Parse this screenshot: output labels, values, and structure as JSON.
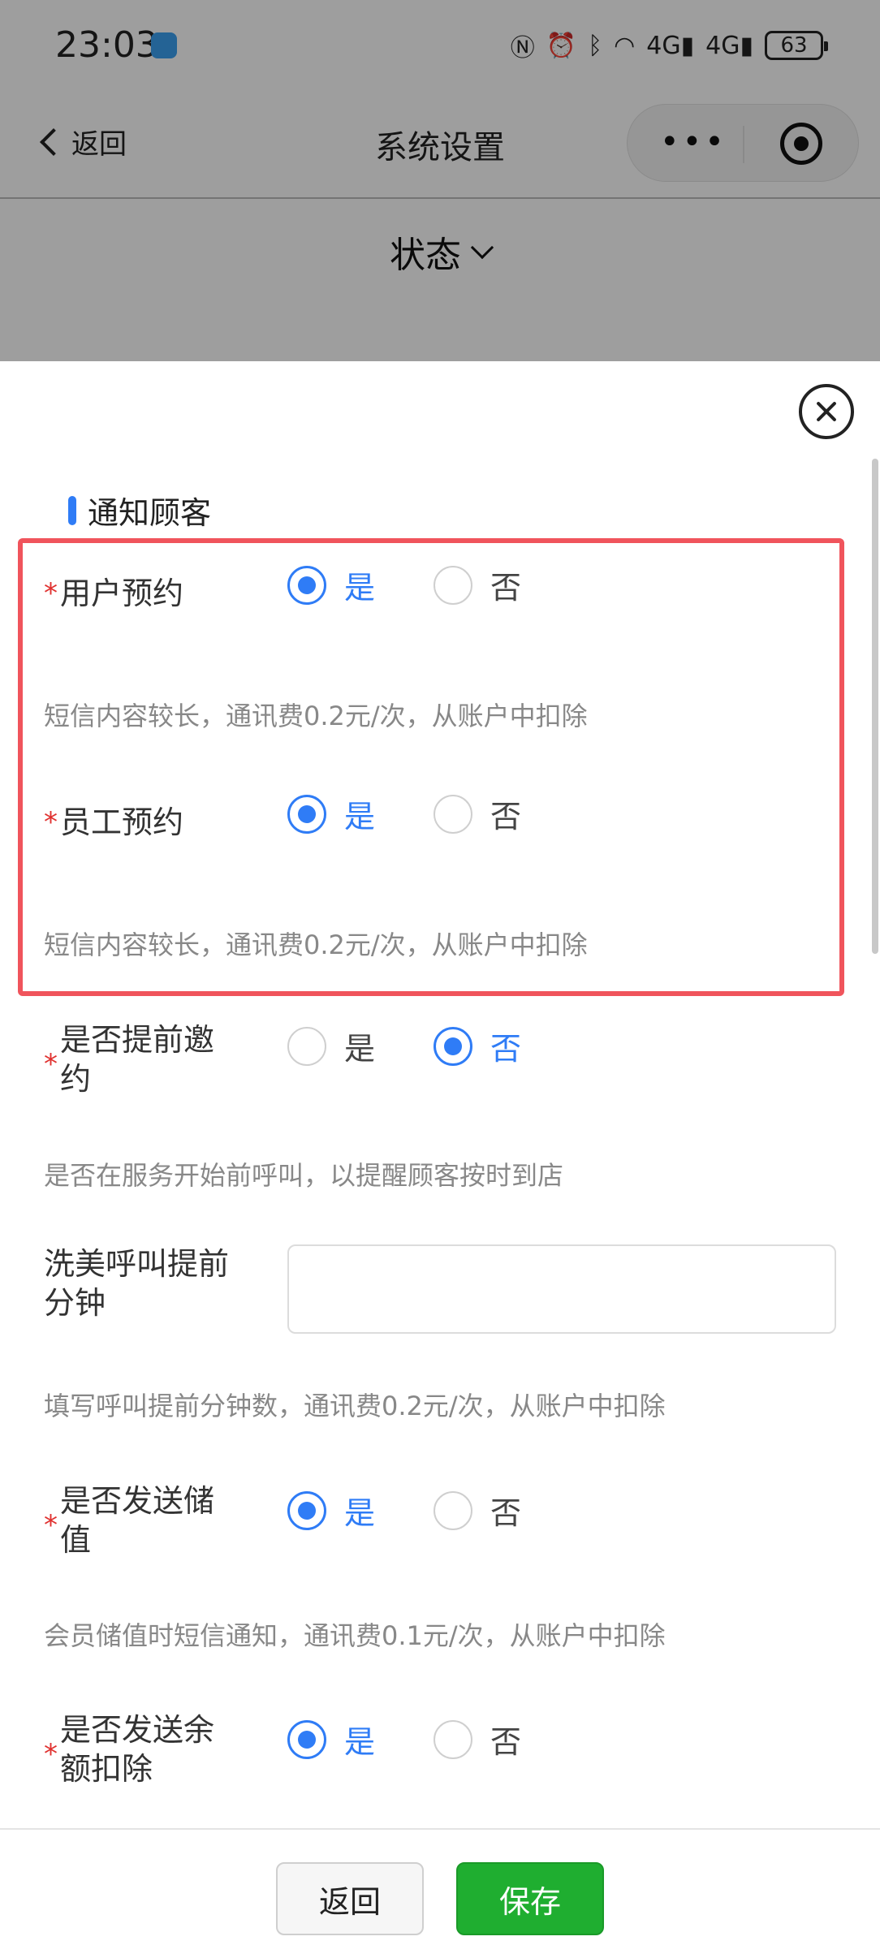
{
  "status_bar": {
    "time": "23:03",
    "icons": [
      "nfc-icon",
      "alarm-icon",
      "bluetooth-icon",
      "wifi-icon",
      "4g-signal-icon",
      "4g-signal-icon"
    ],
    "net1": "4G",
    "net2": "4G",
    "battery": "63"
  },
  "nav": {
    "back_label": "返回",
    "title": "系统设置"
  },
  "filter": {
    "label": "状态"
  },
  "section": {
    "title": "通知顾客"
  },
  "fields": {
    "user_booking": {
      "label": "用户预约",
      "yes": "是",
      "no": "否",
      "selected": "是",
      "hint": "短信内容较长，通讯费0.2元/次，从账户中扣除"
    },
    "staff_booking": {
      "label": "员工预约",
      "yes": "是",
      "no": "否",
      "selected": "是",
      "hint": "短信内容较长，通讯费0.2元/次，从账户中扣除"
    },
    "invite_ahead": {
      "label_line1": "是否提前邀",
      "label_line2": "约",
      "yes": "是",
      "no": "否",
      "selected": "否",
      "hint": "是否在服务开始前呼叫，以提醒顾客按时到店"
    },
    "call_minutes": {
      "label_line1": "洗美呼叫提前",
      "label_line2": "分钟",
      "value": "",
      "hint": "填写呼叫提前分钟数，通讯费0.2元/次，从账户中扣除"
    },
    "send_recharge": {
      "label_line1": "是否发送储",
      "label_line2": "值",
      "yes": "是",
      "no": "否",
      "selected": "是",
      "hint": "会员储值时短信通知，通讯费0.1元/次，从账户中扣除"
    },
    "send_balance": {
      "label_line1": "是否发送余",
      "label_line2": "额扣除",
      "yes": "是",
      "no": "否",
      "selected": "是"
    }
  },
  "footer": {
    "back_label": "返回",
    "save_label": "保存"
  },
  "colors": {
    "accent": "#2f7cf6",
    "required": "#e0312f",
    "highlight": "#f0545c",
    "save": "#1fae30"
  }
}
